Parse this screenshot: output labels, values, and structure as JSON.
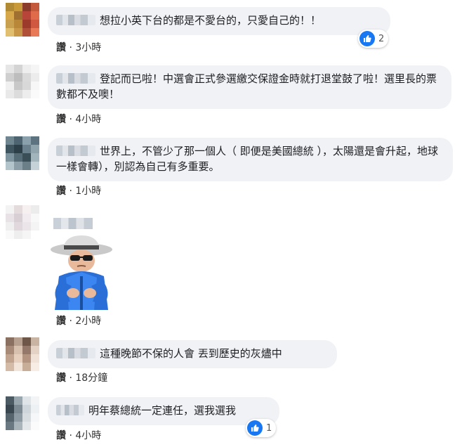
{
  "comments": [
    {
      "text": "想拉小英下台的都是不愛台的，只愛自己的！！",
      "like_label": "讚",
      "time": "3小時",
      "reaction_count": "2"
    },
    {
      "text": "登記而已啦！中選會正式參選繳交保證金時就打退堂鼓了啦！選里長的票數都不及噢！",
      "like_label": "讚",
      "time": "4小時"
    },
    {
      "text": "世界上，不管少了那一個人（ 即便是美國總統 ），太陽還是會升起，地球一樣會轉），別認為自己有多重要。",
      "like_label": "讚",
      "time": "1小時"
    },
    {
      "text": "",
      "like_label": "讚",
      "time": "2小時"
    },
    {
      "text": "這種晚節不保的人會 丟到歷史的灰燼中",
      "like_label": "讚",
      "time": "18分鐘"
    },
    {
      "text": "明年蔡總統一定連任，選我選我",
      "like_label": "讚",
      "time": "4小時",
      "reaction_count": "1"
    }
  ],
  "meta_separator": " · ",
  "colors": {
    "bubble": "#f0f2f5",
    "like_blue": "#1877f2"
  }
}
